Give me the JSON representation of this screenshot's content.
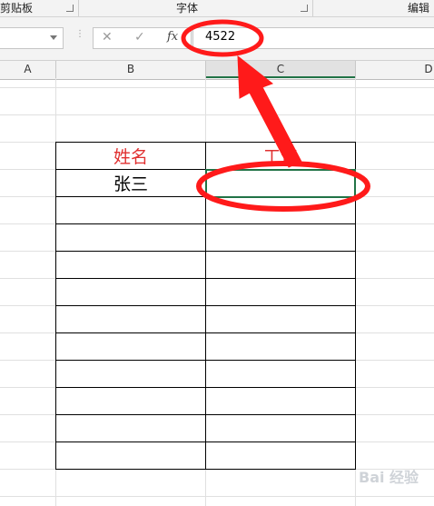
{
  "ribbon": {
    "groups": [
      {
        "label": "剪贴板"
      },
      {
        "label": "字体"
      },
      {
        "label": "编辑"
      }
    ]
  },
  "formula_bar": {
    "cancel_icon": "✕",
    "confirm_icon": "✓",
    "fx_label": "fx",
    "value": "4522"
  },
  "columns": [
    "A",
    "B",
    "C",
    "D"
  ],
  "table": {
    "headers": [
      "姓名",
      "工资"
    ],
    "rows": [
      [
        "张三",
        ""
      ]
    ]
  },
  "watermark": "Bai 经验",
  "colors": {
    "header_text": "#e03030",
    "annotation": "#ff1a1a",
    "selection": "#217346"
  }
}
